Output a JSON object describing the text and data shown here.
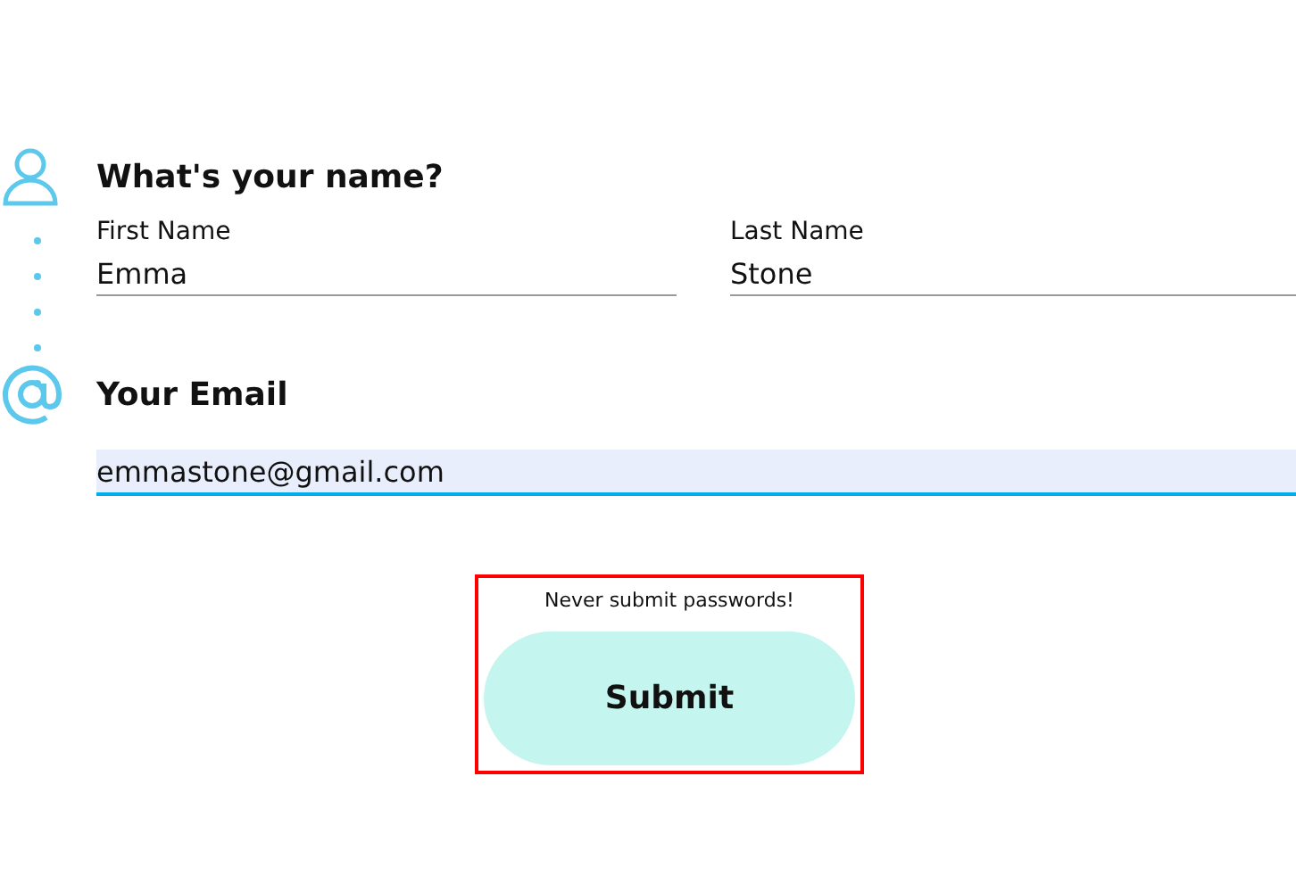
{
  "name_section": {
    "heading": "What's your name?",
    "fields": [
      {
        "label": "First Name",
        "value": "Emma"
      },
      {
        "label": "Last Name",
        "value": "Stone"
      }
    ]
  },
  "email_section": {
    "heading": "Your Email",
    "value": "emmastone@gmail.com",
    "focused": true
  },
  "submit_area": {
    "note": "Never submit passwords!",
    "button": "Submit"
  }
}
